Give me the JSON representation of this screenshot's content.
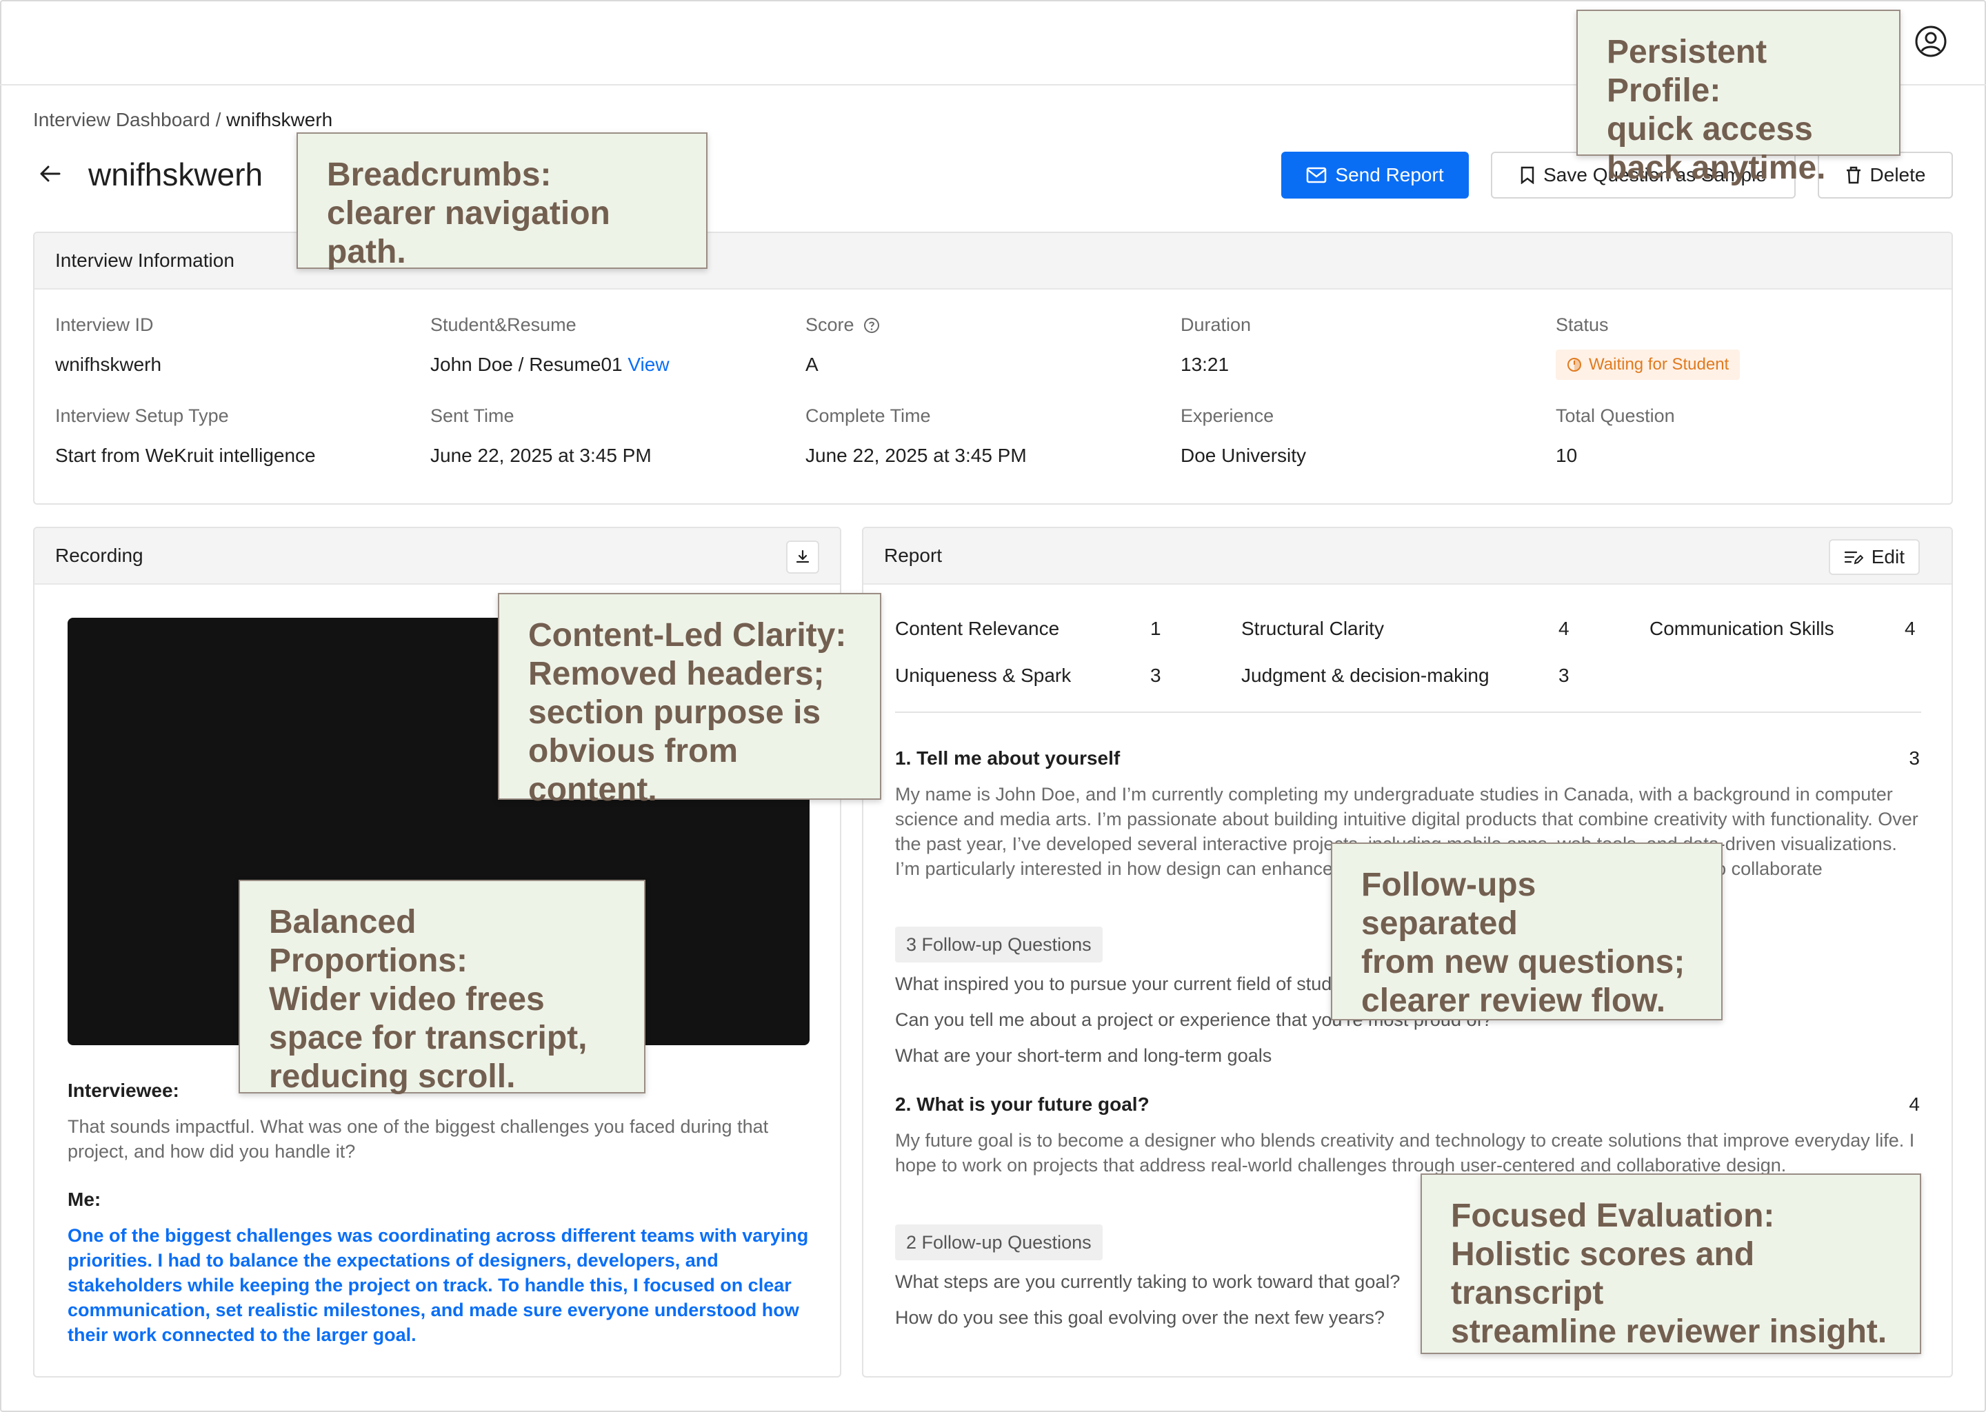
{
  "breadcrumb": {
    "parent": "Interview Dashboard",
    "separator": " / ",
    "current": "wnifhskwerh"
  },
  "page": {
    "title": "wnifhskwerh"
  },
  "actions": {
    "send_report": "Send Report",
    "save_sample": "Save Question as Sample",
    "delete": "Delete"
  },
  "info": {
    "header": "Interview Information",
    "fields": [
      {
        "label": "Interview ID",
        "value": "wnifhskwerh"
      },
      {
        "label": "Student&Resume",
        "value": "John Doe / Resume01 ",
        "link": "View"
      },
      {
        "label": "Score",
        "value": "A"
      },
      {
        "label": "Duration",
        "value": "13:21"
      },
      {
        "label": "Status",
        "value": "Waiting for Student"
      },
      {
        "label": "Interview Setup Type",
        "value": "Start from WeKruit intelligence"
      },
      {
        "label": "Sent Time",
        "value": "June 22, 2025 at 3:45 PM"
      },
      {
        "label": "Complete Time",
        "value": "June 22, 2025 at 3:45 PM"
      },
      {
        "label": "Experience",
        "value": "Doe University"
      },
      {
        "label": "Total Question",
        "value": "10"
      }
    ]
  },
  "recording": {
    "header": "Recording",
    "interviewee_label": "Interviewee:",
    "interviewee_text": "That sounds impactful. What was one of the biggest challenges you faced during that project, and how did you handle it?",
    "me_label": "Me:",
    "me_text": "One of the biggest challenges was coordinating across different teams with varying priorities. I had to balance the expectations of designers, developers, and stakeholders while keeping the project on track. To handle this, I focused on clear communication, set realistic milestones, and made sure everyone understood how their work connected to the larger goal."
  },
  "report": {
    "header": "Report",
    "edit": "Edit",
    "scores": [
      {
        "name": "Content Relevance",
        "value": "1"
      },
      {
        "name": "Structural Clarity",
        "value": "4"
      },
      {
        "name": "Communication Skills",
        "value": "4"
      },
      {
        "name": "Uniqueness & Spark",
        "value": "3"
      },
      {
        "name": "Judgment & decision-making",
        "value": "3"
      }
    ],
    "questions": [
      {
        "title": "1. Tell me about yourself",
        "score": "3",
        "answer": "My name is John Doe, and I’m currently completing my undergraduate studies in Canada, with a background in computer science and media arts. I’m passionate about building intuitive digital products that combine creativity with functionality. Over the past year, I’ve developed several interactive projects, including mobile apps, web tools, and data-driven visualizations. I’m particularly interested in how design can enhance everyday experiences, and I’m always eager to collaborate",
        "followup_tag": "3 Follow-up Questions",
        "followups": [
          "What inspired you to pursue your current field of study?",
          "Can you tell me about a project or experience that you’re most proud of?",
          "What are your short-term and long-term goals"
        ]
      },
      {
        "title": "2. What is your future goal?",
        "score": "4",
        "answer": "My future goal is to become a designer who blends creativity and technology to create solutions that improve everyday life. I hope to work on projects that address real-world challenges through user-centered and collaborative design.",
        "followup_tag": "2 Follow-up Questions",
        "followups": [
          "What steps are you currently taking to work toward that goal?",
          "How do you see this goal evolving over the next few years?"
        ]
      }
    ]
  },
  "annotations": {
    "profile": "Persistent Profile:\nquick access\nback anytime.",
    "breadcrumbs": "Breadcrumbs:\nclearer navigation path.",
    "content": "Content-Led Clarity:\nRemoved headers;\nsection purpose is\nobvious from content.",
    "proportions": "Balanced Proportions:\nWider video frees\nspace for transcript,\nreducing scroll.",
    "followups": "Follow-ups separated\nfrom new questions;\nclearer review flow.",
    "evaluation": "Focused Evaluation:\nHolistic scores and transcript\nstreamline reviewer insight."
  },
  "colors": {
    "primary": "#0a6ef5",
    "status": "#e07a1f",
    "note_bg": "#eef3e8",
    "note_text": "#735f50"
  },
  "icons": [
    "user-circle-icon",
    "arrow-left-icon",
    "mail-icon",
    "bookmark-icon",
    "trash-icon",
    "help-circle-icon",
    "clock-icon",
    "download-icon",
    "edit-icon"
  ]
}
